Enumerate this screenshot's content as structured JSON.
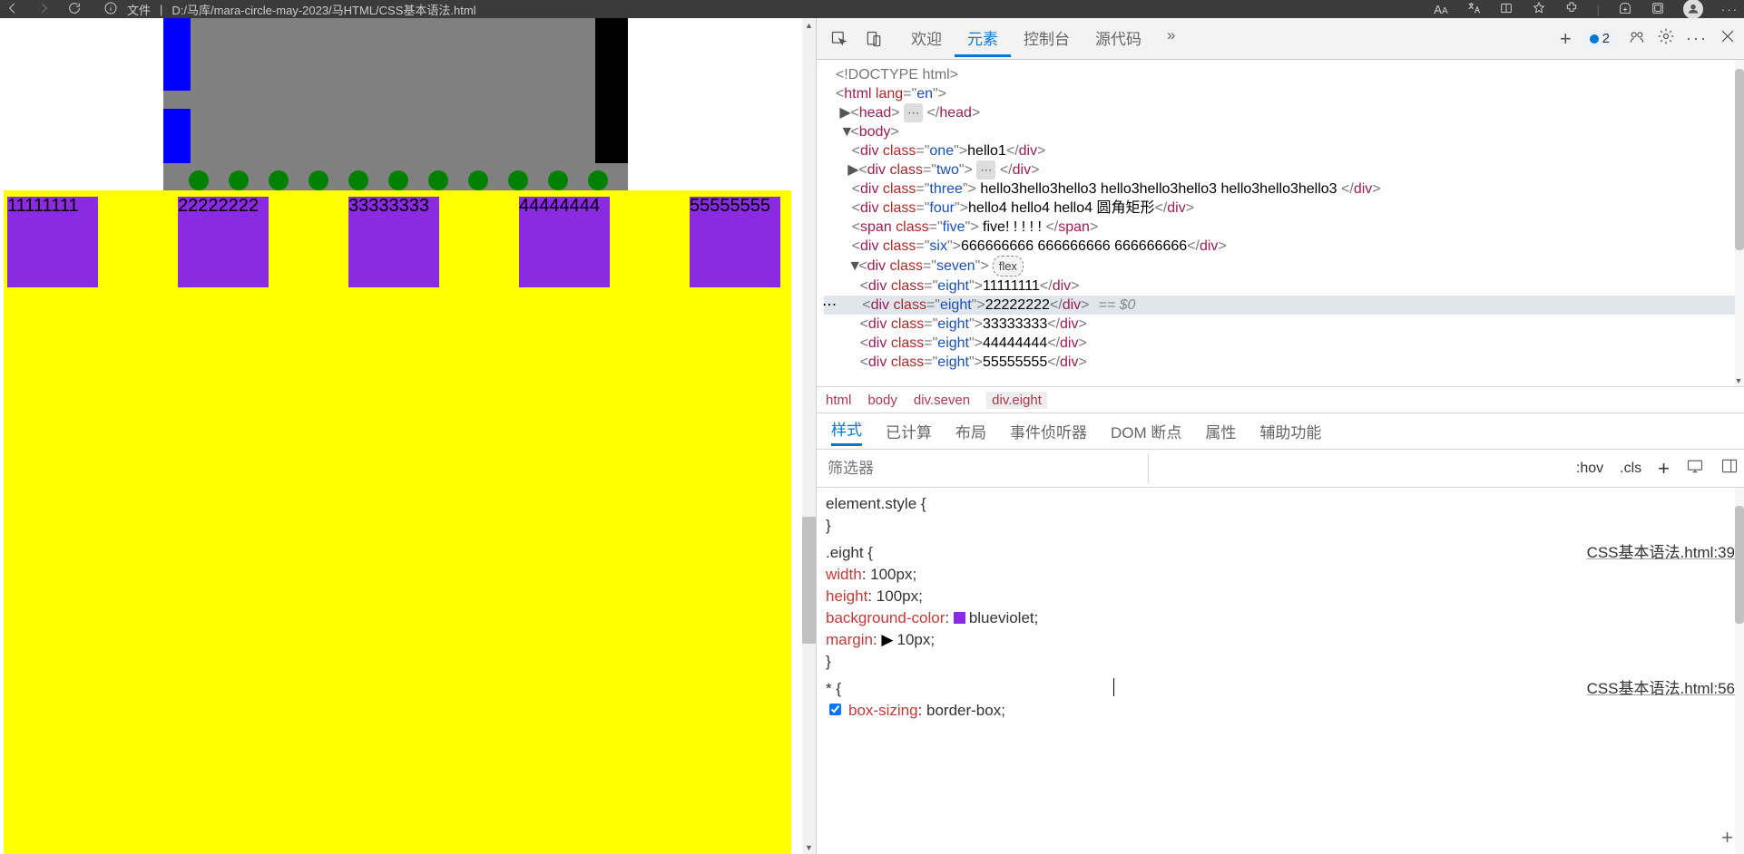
{
  "browser": {
    "file_label": "文件",
    "url": "D:/马库/mara-circle-may-2023/马HTML/CSS基本语法.html",
    "right_icons": [
      "aa-icon",
      "translate-icon",
      "read-icon",
      "favorite-icon",
      "extension-icon",
      "collections-icon",
      "app-icon",
      "avatar-icon",
      "more-icon"
    ]
  },
  "page": {
    "eight_labels": [
      "11111111",
      "22222222",
      "33333333",
      "44444444",
      "55555555"
    ]
  },
  "devtools": {
    "tabs": {
      "welcome": "欢迎",
      "elements": "元素",
      "console": "控制台",
      "sources": "源代码",
      "more": "»"
    },
    "issues_count": "2",
    "doctype": "<!DOCTYPE html>",
    "html_open": {
      "tag": "html",
      "attr": "lang",
      "val": "en"
    },
    "head": "head",
    "body": "body",
    "lines": {
      "one": {
        "tag": "div",
        "cls": "one",
        "txt": "hello1"
      },
      "two": {
        "tag": "div",
        "cls": "two"
      },
      "three_txt": "hello3hello3hello3 hello3hello3hello3 hello3hello3hello3",
      "three": {
        "tag": "div",
        "cls": "three"
      },
      "four": {
        "tag": "div",
        "cls": "four",
        "txt": "hello4 hello4 hello4 圆角矩形"
      },
      "five": {
        "tag": "span",
        "cls": "five",
        "txt": "five! ! ! ! !"
      },
      "six": {
        "tag": "div",
        "cls": "six",
        "txt": "666666666 666666666 666666666"
      },
      "seven": {
        "tag": "div",
        "cls": "seven",
        "badge": "flex"
      },
      "eight": [
        {
          "txt": "11111111"
        },
        {
          "txt": "22222222"
        },
        {
          "txt": "33333333"
        },
        {
          "txt": "44444444"
        },
        {
          "txt": "55555555"
        }
      ]
    },
    "crumbs": [
      "html",
      "body",
      "div.seven",
      "div.eight"
    ],
    "styles_tabs": [
      "样式",
      "已计算",
      "布局",
      "事件侦听器",
      "DOM 断点",
      "属性",
      "辅助功能"
    ],
    "filter_placeholder": "筛选器",
    "hov": ":hov",
    "cls": ".cls",
    "styles": {
      "element_style": "element.style {",
      "close": "}",
      "sel_eight": ".eight {",
      "src_eight": "CSS基本语法.html:39",
      "width": {
        "p": "width",
        "v": "100px"
      },
      "height": {
        "p": "height",
        "v": "100px"
      },
      "bg": {
        "p": "background-color",
        "v": "blueviolet"
      },
      "margin": {
        "p": "margin",
        "v": "10px"
      },
      "sel_star": "* {",
      "src_star": "CSS基本语法.html:56",
      "boxsizing": {
        "p": "box-sizing",
        "v": "border-box"
      }
    }
  }
}
